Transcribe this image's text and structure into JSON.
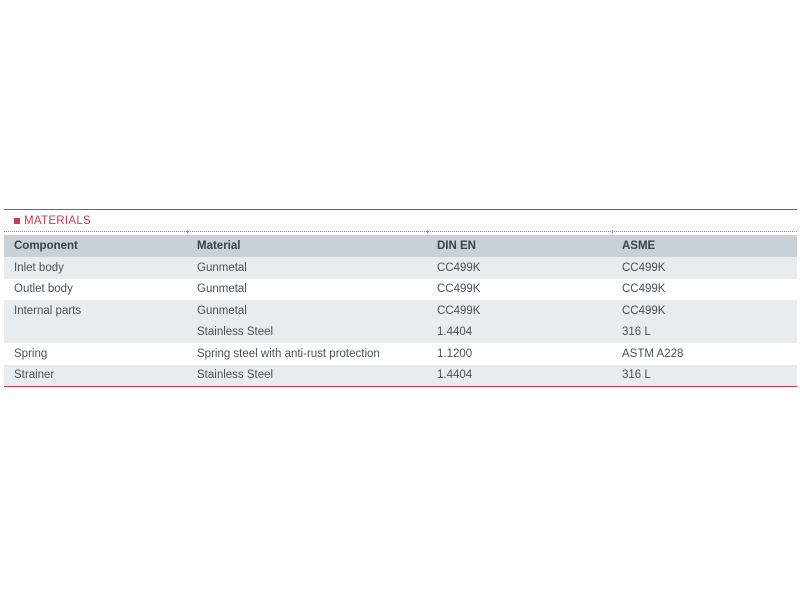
{
  "section": {
    "title": "MATERIALS",
    "marker_color": "#cf3a55"
  },
  "table": {
    "headers": [
      "Component",
      "Material",
      "DIN EN",
      "ASME"
    ],
    "rows": [
      [
        "Inlet body",
        "Gunmetal",
        "CC499K",
        "CC499K"
      ],
      [
        "Outlet body",
        "Gunmetal",
        "CC499K",
        "CC499K"
      ],
      [
        "Internal parts",
        "Gunmetal",
        "CC499K",
        "CC499K"
      ],
      [
        "",
        "Stainless Steel",
        "1.4404",
        "316 L"
      ],
      [
        "Spring",
        "Spring steel with anti-rust protection",
        "1.1200",
        "ASTM A228"
      ],
      [
        "Strainer",
        "Stainless Steel",
        "1.4404",
        "316 L"
      ]
    ]
  },
  "colors": {
    "accent": "#cf3a55",
    "header_bg": "#c9d1d6",
    "stripe_bg": "#e7ecee",
    "text": "#4a5158"
  }
}
